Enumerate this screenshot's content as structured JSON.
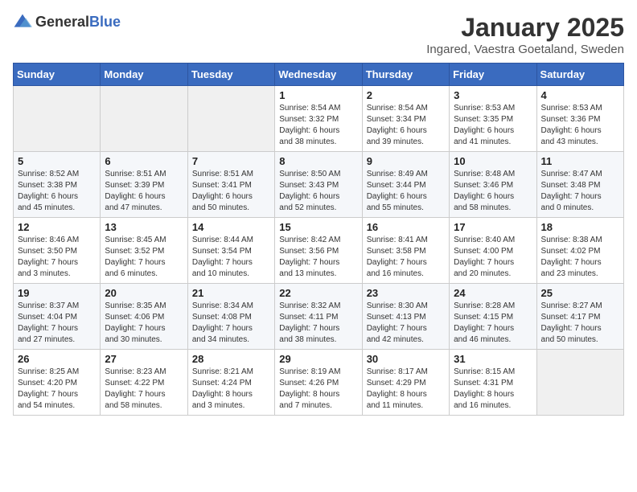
{
  "logo": {
    "general": "General",
    "blue": "Blue"
  },
  "header": {
    "month": "January 2025",
    "location": "Ingared, Vaestra Goetaland, Sweden"
  },
  "weekdays": [
    "Sunday",
    "Monday",
    "Tuesday",
    "Wednesday",
    "Thursday",
    "Friday",
    "Saturday"
  ],
  "weeks": [
    [
      {
        "day": "",
        "info": ""
      },
      {
        "day": "",
        "info": ""
      },
      {
        "day": "",
        "info": ""
      },
      {
        "day": "1",
        "info": "Sunrise: 8:54 AM\nSunset: 3:32 PM\nDaylight: 6 hours\nand 38 minutes."
      },
      {
        "day": "2",
        "info": "Sunrise: 8:54 AM\nSunset: 3:34 PM\nDaylight: 6 hours\nand 39 minutes."
      },
      {
        "day": "3",
        "info": "Sunrise: 8:53 AM\nSunset: 3:35 PM\nDaylight: 6 hours\nand 41 minutes."
      },
      {
        "day": "4",
        "info": "Sunrise: 8:53 AM\nSunset: 3:36 PM\nDaylight: 6 hours\nand 43 minutes."
      }
    ],
    [
      {
        "day": "5",
        "info": "Sunrise: 8:52 AM\nSunset: 3:38 PM\nDaylight: 6 hours\nand 45 minutes."
      },
      {
        "day": "6",
        "info": "Sunrise: 8:51 AM\nSunset: 3:39 PM\nDaylight: 6 hours\nand 47 minutes."
      },
      {
        "day": "7",
        "info": "Sunrise: 8:51 AM\nSunset: 3:41 PM\nDaylight: 6 hours\nand 50 minutes."
      },
      {
        "day": "8",
        "info": "Sunrise: 8:50 AM\nSunset: 3:43 PM\nDaylight: 6 hours\nand 52 minutes."
      },
      {
        "day": "9",
        "info": "Sunrise: 8:49 AM\nSunset: 3:44 PM\nDaylight: 6 hours\nand 55 minutes."
      },
      {
        "day": "10",
        "info": "Sunrise: 8:48 AM\nSunset: 3:46 PM\nDaylight: 6 hours\nand 58 minutes."
      },
      {
        "day": "11",
        "info": "Sunrise: 8:47 AM\nSunset: 3:48 PM\nDaylight: 7 hours\nand 0 minutes."
      }
    ],
    [
      {
        "day": "12",
        "info": "Sunrise: 8:46 AM\nSunset: 3:50 PM\nDaylight: 7 hours\nand 3 minutes."
      },
      {
        "day": "13",
        "info": "Sunrise: 8:45 AM\nSunset: 3:52 PM\nDaylight: 7 hours\nand 6 minutes."
      },
      {
        "day": "14",
        "info": "Sunrise: 8:44 AM\nSunset: 3:54 PM\nDaylight: 7 hours\nand 10 minutes."
      },
      {
        "day": "15",
        "info": "Sunrise: 8:42 AM\nSunset: 3:56 PM\nDaylight: 7 hours\nand 13 minutes."
      },
      {
        "day": "16",
        "info": "Sunrise: 8:41 AM\nSunset: 3:58 PM\nDaylight: 7 hours\nand 16 minutes."
      },
      {
        "day": "17",
        "info": "Sunrise: 8:40 AM\nSunset: 4:00 PM\nDaylight: 7 hours\nand 20 minutes."
      },
      {
        "day": "18",
        "info": "Sunrise: 8:38 AM\nSunset: 4:02 PM\nDaylight: 7 hours\nand 23 minutes."
      }
    ],
    [
      {
        "day": "19",
        "info": "Sunrise: 8:37 AM\nSunset: 4:04 PM\nDaylight: 7 hours\nand 27 minutes."
      },
      {
        "day": "20",
        "info": "Sunrise: 8:35 AM\nSunset: 4:06 PM\nDaylight: 7 hours\nand 30 minutes."
      },
      {
        "day": "21",
        "info": "Sunrise: 8:34 AM\nSunset: 4:08 PM\nDaylight: 7 hours\nand 34 minutes."
      },
      {
        "day": "22",
        "info": "Sunrise: 8:32 AM\nSunset: 4:11 PM\nDaylight: 7 hours\nand 38 minutes."
      },
      {
        "day": "23",
        "info": "Sunrise: 8:30 AM\nSunset: 4:13 PM\nDaylight: 7 hours\nand 42 minutes."
      },
      {
        "day": "24",
        "info": "Sunrise: 8:28 AM\nSunset: 4:15 PM\nDaylight: 7 hours\nand 46 minutes."
      },
      {
        "day": "25",
        "info": "Sunrise: 8:27 AM\nSunset: 4:17 PM\nDaylight: 7 hours\nand 50 minutes."
      }
    ],
    [
      {
        "day": "26",
        "info": "Sunrise: 8:25 AM\nSunset: 4:20 PM\nDaylight: 7 hours\nand 54 minutes."
      },
      {
        "day": "27",
        "info": "Sunrise: 8:23 AM\nSunset: 4:22 PM\nDaylight: 7 hours\nand 58 minutes."
      },
      {
        "day": "28",
        "info": "Sunrise: 8:21 AM\nSunset: 4:24 PM\nDaylight: 8 hours\nand 3 minutes."
      },
      {
        "day": "29",
        "info": "Sunrise: 8:19 AM\nSunset: 4:26 PM\nDaylight: 8 hours\nand 7 minutes."
      },
      {
        "day": "30",
        "info": "Sunrise: 8:17 AM\nSunset: 4:29 PM\nDaylight: 8 hours\nand 11 minutes."
      },
      {
        "day": "31",
        "info": "Sunrise: 8:15 AM\nSunset: 4:31 PM\nDaylight: 8 hours\nand 16 minutes."
      },
      {
        "day": "",
        "info": ""
      }
    ]
  ]
}
